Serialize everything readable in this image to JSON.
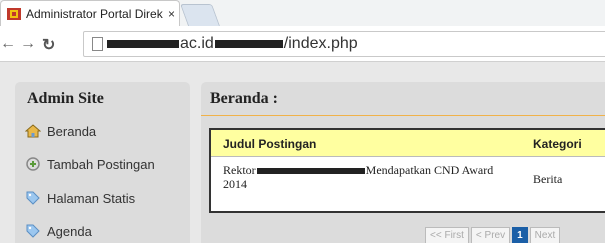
{
  "browser": {
    "tab_title": "Administrator Portal Direk",
    "tab_close": "×",
    "url_prefix": "ac.id",
    "url_suffix": "/index.php"
  },
  "sidebar": {
    "title": "Admin Site",
    "items": [
      {
        "label": "Beranda",
        "icon": "home-icon"
      },
      {
        "label": "Tambah Postingan",
        "icon": "add-icon"
      },
      {
        "label": "Halaman Statis",
        "icon": "tag-icon"
      },
      {
        "label": "Agenda",
        "icon": "tag-icon"
      }
    ]
  },
  "main": {
    "title": "Beranda :",
    "table": {
      "headers": [
        "Judul Postingan",
        "Kategori"
      ],
      "rows": [
        {
          "title_start": "Rektor",
          "title_end": "Mendapatkan CND Award",
          "title_line2": "2014",
          "category": "Berita"
        }
      ]
    },
    "pager": [
      "<< First",
      "< Prev",
      "1",
      "Next"
    ]
  },
  "colors": {
    "header_bg": "#ffffa0",
    "accent_rule": "#f0b24a",
    "pager_active": "#1b5fa7"
  }
}
